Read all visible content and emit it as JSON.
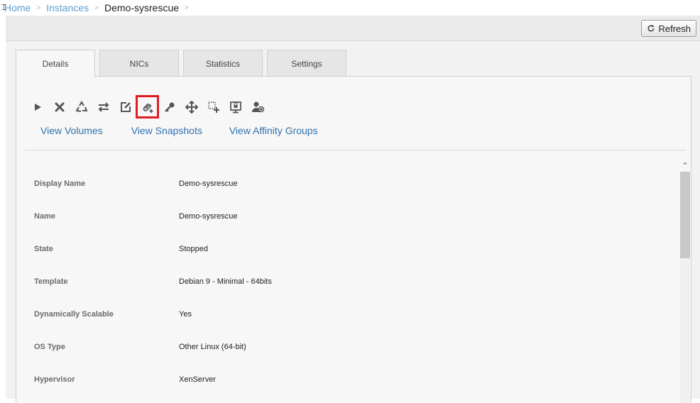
{
  "breadcrumb": {
    "home": "Home",
    "instances": "Instances",
    "current": "Demo-sysrescue",
    "separator": ">"
  },
  "toolbar": {
    "refresh_label": "Refresh"
  },
  "tabs": [
    {
      "label": "Details",
      "active": true
    },
    {
      "label": "NICs",
      "active": false
    },
    {
      "label": "Statistics",
      "active": false
    },
    {
      "label": "Settings",
      "active": false
    }
  ],
  "actions": [
    {
      "icon": "start-icon"
    },
    {
      "icon": "destroy-icon"
    },
    {
      "icon": "recycle-icon"
    },
    {
      "icon": "swap-icon"
    },
    {
      "icon": "edit-icon"
    },
    {
      "icon": "attach-iso-icon",
      "highlighted": true
    },
    {
      "icon": "key-icon"
    },
    {
      "icon": "move-icon"
    },
    {
      "icon": "scale-icon"
    },
    {
      "icon": "console-icon"
    },
    {
      "icon": "assign-user-icon"
    }
  ],
  "view_links": {
    "volumes": "View Volumes",
    "snapshots": "View Snapshots",
    "affinity_groups": "View Affinity Groups"
  },
  "details": [
    {
      "label": "Display Name",
      "value": "Demo-sysrescue"
    },
    {
      "label": "Name",
      "value": "Demo-sysrescue"
    },
    {
      "label": "State",
      "value": "Stopped"
    },
    {
      "label": "Template",
      "value": "Debian 9 - Minimal - 64bits"
    },
    {
      "label": "Dynamically Scalable",
      "value": "Yes"
    },
    {
      "label": "OS Type",
      "value": "Other Linux (64-bit)"
    },
    {
      "label": "Hypervisor",
      "value": "XenServer"
    }
  ],
  "colors": {
    "link": "#2f72ad",
    "breadcrumb_link": "#5b9fd1",
    "highlight": "#e01b24"
  }
}
